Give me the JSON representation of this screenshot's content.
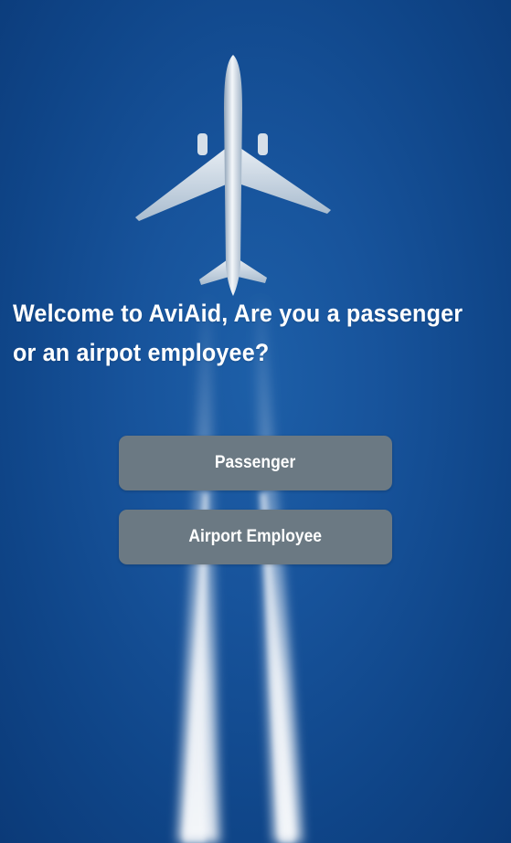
{
  "welcome": {
    "heading": "Welcome to AviAid, Are you a passenger or an airpot employee?"
  },
  "actions": {
    "passenger_label": "Passenger",
    "employee_label": "Airport Employee"
  },
  "colors": {
    "sky": "#17539b",
    "button": "#6b7983",
    "text": "#ffffff"
  },
  "icons": {
    "background": "airplane-contrail-image"
  }
}
